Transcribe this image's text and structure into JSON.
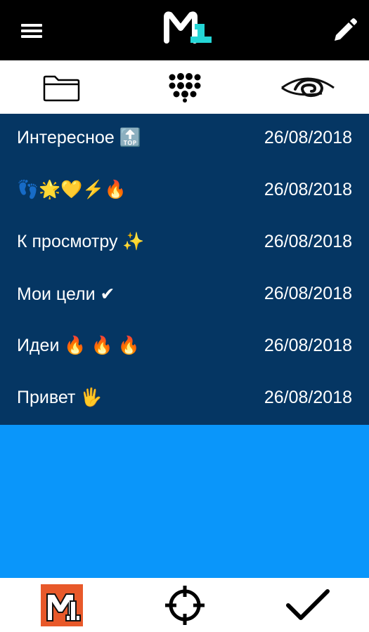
{
  "app": {
    "accent_color": "#24d6d6",
    "header_bg": "#000000",
    "list_bg": "#053663",
    "content_bg": "#0a96fa",
    "brand_orange": "#e8592a"
  },
  "header": {
    "menu_icon": "hamburger-menu-icon",
    "logo": "app-logo-m1",
    "edit_icon": "pencil-icon"
  },
  "tabs": [
    {
      "icon": "folder-icon"
    },
    {
      "icon": "dial-pad-icon"
    },
    {
      "icon": "eye-icon"
    }
  ],
  "notes": [
    {
      "title": "Интересное 🔝",
      "date": "26/08/2018"
    },
    {
      "title": "👣🌟💛⚡🔥",
      "date": "26/08/2018"
    },
    {
      "title": "К просмотру ✨",
      "date": "26/08/2018"
    },
    {
      "title": "Мои цели ✔",
      "date": "26/08/2018"
    },
    {
      "title": "Идеи 🔥 🔥 🔥",
      "date": "26/08/2018"
    },
    {
      "title": "Привет 🖐",
      "date": "26/08/2018"
    }
  ],
  "bottom_nav": [
    {
      "icon": "app-logo-orange-icon"
    },
    {
      "icon": "crosshair-target-icon"
    },
    {
      "icon": "checkmark-icon"
    }
  ]
}
